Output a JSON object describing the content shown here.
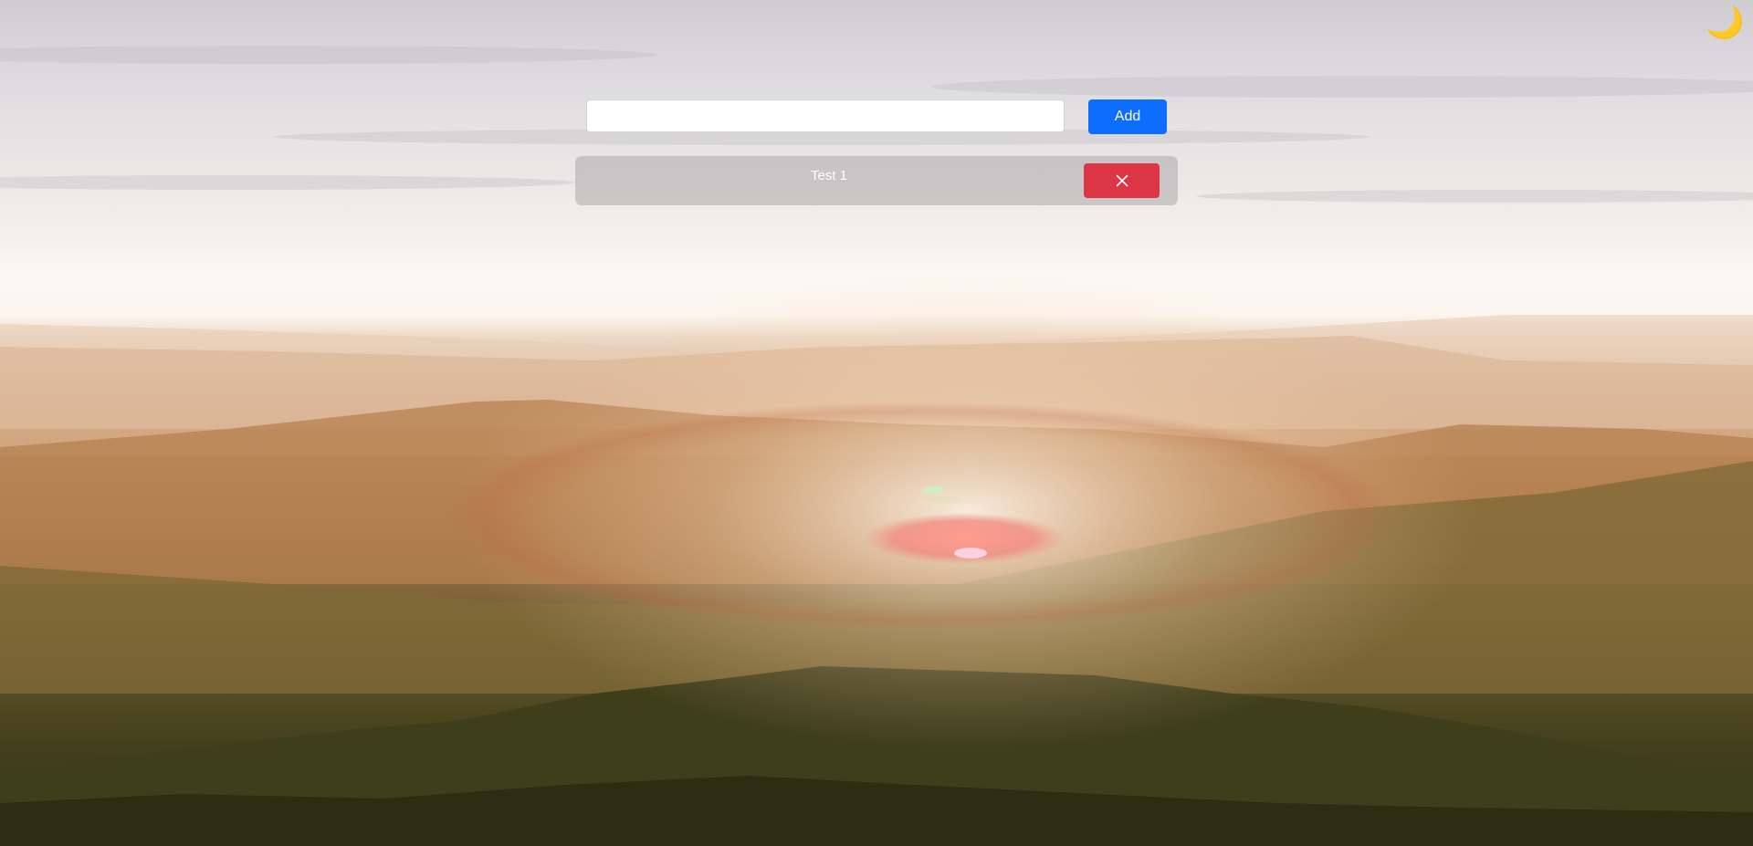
{
  "theme_toggle": {
    "icon": "moon-icon",
    "glyph": "🌙",
    "color": "#f2b12a"
  },
  "new_task": {
    "value": "",
    "placeholder": ""
  },
  "add_button": {
    "label": "Add",
    "color": "#0d6efd"
  },
  "tasks": [
    {
      "text": "Test 1",
      "delete_icon": "close-icon",
      "delete_color": "#dc3545"
    }
  ]
}
